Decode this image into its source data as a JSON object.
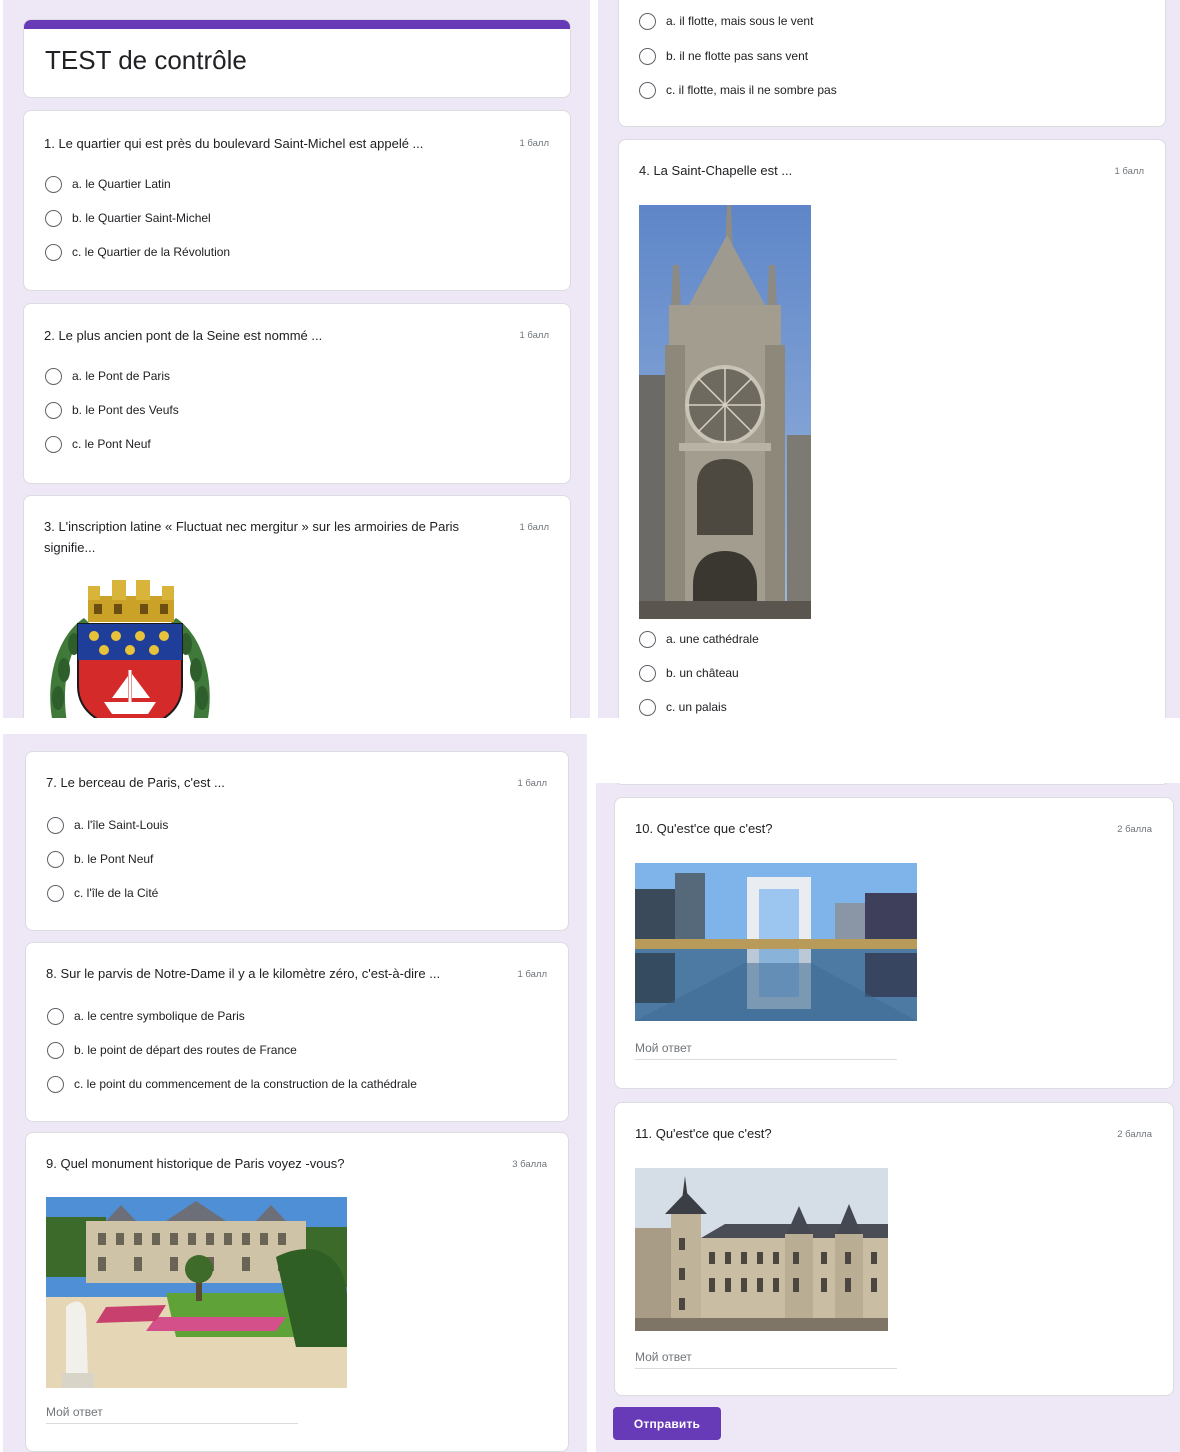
{
  "form": {
    "title": "TEST de contrôle",
    "answer_placeholder": "Мой ответ",
    "submit_label": "Отправить"
  },
  "questions": [
    {
      "title": "1. Le quartier qui est près du boulevard Saint-Michel est appelé ...",
      "points": "1 балл",
      "options": [
        "a. le Quartier Latin",
        "b. le Quartier Saint-Michel",
        "c. le Quartier de la Révolution"
      ]
    },
    {
      "title": "2. Le plus ancien pont de la Seine est nommé ...",
      "points": "1 балл",
      "options": [
        "a. le Pont de Paris",
        "b. le Pont des Veufs",
        "c. le Pont Neuf"
      ]
    },
    {
      "title": "3. L'inscription latine « Fluctuat nec mergitur » sur les armoiries de Paris signifie...",
      "points": "1 балл",
      "image": "coat-of-arms-of-paris",
      "options": [
        "a. il flotte, mais sous le vent",
        "b. il ne flotte pas sans vent",
        "c. il flotte, mais il ne sombre pas"
      ]
    },
    {
      "title": "4. La Saint-Chapelle est ...",
      "points": "1 балл",
      "image": "sainte-chapelle-photo",
      "options": [
        "a. une cathédrale",
        "b. un château",
        "c. un palais"
      ]
    },
    {
      "title": "7. Le berceau de Paris, c'est ...",
      "points": "1 балл",
      "options": [
        "a. l'île Saint-Louis",
        "b. le Pont Neuf",
        "c. l'île de la Cité"
      ]
    },
    {
      "title": "8. Sur le parvis de Notre-Dame il y a le kilomètre zéro, c'est-à-dire ...",
      "points": "1 балл",
      "options": [
        "a. le centre symbolique de Paris",
        "b. le point de départ des routes de France",
        "c. le point du commencement de la construction de la cathédrale"
      ]
    },
    {
      "title": "9. Quel monument historique de Paris voyez -vous?",
      "points": "3 балла",
      "image": "luxembourg-palace-photo"
    },
    {
      "title": "10. Qu'est'ce que c'est?",
      "points": "2 балла",
      "image": "grande-arche-photo"
    },
    {
      "title": "11. Qu'est'ce que c'est?",
      "points": "2 балла",
      "image": "conciergerie-photo"
    }
  ],
  "colors": {
    "accent": "#673ab7",
    "page_background": "#ede7f6",
    "card_border": "#dadce0"
  }
}
